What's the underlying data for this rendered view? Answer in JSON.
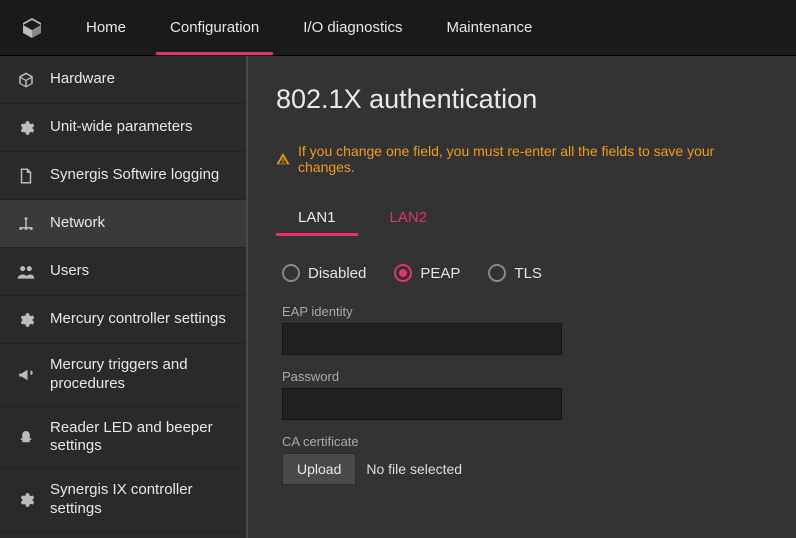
{
  "topnav": {
    "items": [
      {
        "label": "Home"
      },
      {
        "label": "Configuration"
      },
      {
        "label": "I/O diagnostics"
      },
      {
        "label": "Maintenance"
      }
    ],
    "active_index": 1
  },
  "sidebar": {
    "items": [
      {
        "icon": "cube-icon",
        "label": "Hardware"
      },
      {
        "icon": "gear-icon",
        "label": "Unit-wide parameters"
      },
      {
        "icon": "page-icon",
        "label": "Synergis Softwire logging"
      },
      {
        "icon": "network-icon",
        "label": "Network"
      },
      {
        "icon": "users-icon",
        "label": "Users"
      },
      {
        "icon": "gear-icon",
        "label": "Mercury controller settings"
      },
      {
        "icon": "megaphone-icon",
        "label": "Mercury triggers and procedures"
      },
      {
        "icon": "beacon-icon",
        "label": "Reader LED and beeper settings"
      },
      {
        "icon": "gear-icon",
        "label": "Synergis IX controller settings"
      }
    ],
    "active_index": 3
  },
  "page": {
    "title": "802.1X authentication",
    "warning": "If you change one field, you must re-enter all the fields to save your changes."
  },
  "lan_tabs": {
    "items": [
      {
        "label": "LAN1"
      },
      {
        "label": "LAN2"
      }
    ],
    "active_index": 0
  },
  "auth": {
    "options": [
      {
        "label": "Disabled",
        "selected": false
      },
      {
        "label": "PEAP",
        "selected": true
      },
      {
        "label": "TLS",
        "selected": false
      }
    ],
    "eap_identity": {
      "label": "EAP identity",
      "value": ""
    },
    "password": {
      "label": "Password",
      "value": ""
    },
    "ca_cert": {
      "label": "CA certificate",
      "upload_label": "Upload",
      "file_status": "No file selected"
    }
  }
}
